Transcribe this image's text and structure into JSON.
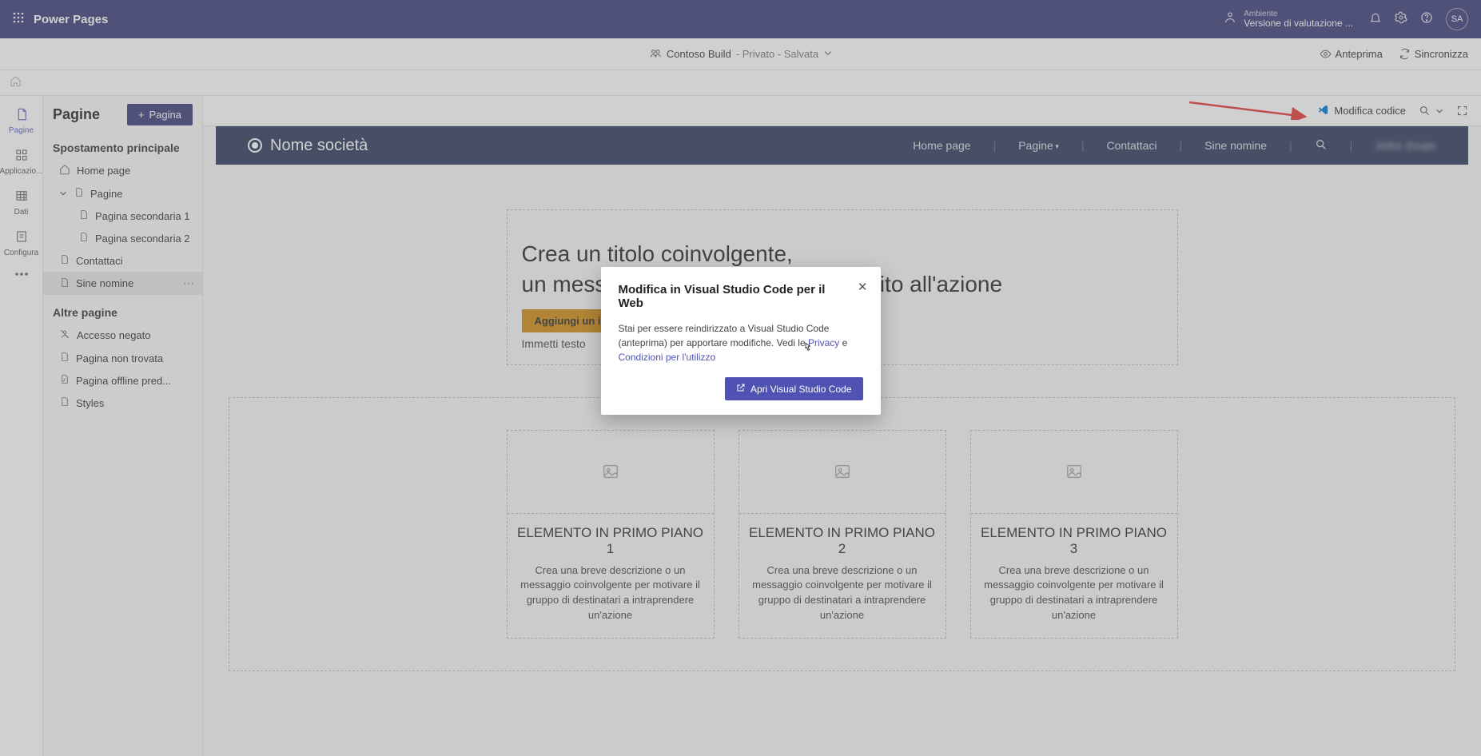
{
  "app_bar": {
    "name": "Power Pages",
    "env_label": "Ambiente",
    "env_value": "Versione di valutazione ...",
    "avatar_initials": "SA"
  },
  "sub_bar": {
    "site_name": "Contoso Build",
    "site_status": "- Privato - Salvata",
    "preview": "Anteprima",
    "sync": "Sincronizza"
  },
  "rail": {
    "pages": "Pagine",
    "apps": "Applicazio...",
    "data": "Dati",
    "setup": "Configura"
  },
  "sidebar": {
    "title": "Pagine",
    "add_page": "Pagina",
    "main_nav": "Spostamento principale",
    "other_pages": "Altre pagine",
    "tree_main": [
      "Home page",
      "Pagine",
      "Pagina secondaria 1",
      "Pagina secondaria 2",
      "Contattaci",
      "Sine nomine"
    ],
    "tree_other": [
      "Accesso negato",
      "Pagina non trovata",
      "Pagina offline pred...",
      "Styles"
    ]
  },
  "design_bar": {
    "edit_code": "Modifica codice"
  },
  "site": {
    "brand": "Nome società",
    "nav": {
      "home": "Home page",
      "pages": "Pagine",
      "contact": "Contattaci",
      "sine": "Sine nomine"
    },
    "hero_line1": "Crea un titolo coinvolgente,",
    "hero_line2": "un messaggio di benvenuto o un invito all'azione",
    "cta": "Aggiungi un invito all'azione",
    "subtext": "Immetti testo",
    "cards": [
      {
        "title": "ELEMENTO IN PRIMO PIANO 1",
        "desc": "Crea una breve descrizione o un messaggio coinvolgente per motivare il gruppo di destinatari a intraprendere un'azione"
      },
      {
        "title": "ELEMENTO IN PRIMO PIANO 2",
        "desc": "Crea una breve descrizione o un messaggio coinvolgente per motivare il gruppo di destinatari a intraprendere un'azione"
      },
      {
        "title": "ELEMENTO IN PRIMO PIANO 3",
        "desc": "Crea una breve descrizione o un messaggio coinvolgente per motivare il gruppo di destinatari a intraprendere un'azione"
      }
    ]
  },
  "modal": {
    "title": "Modifica in Visual Studio Code per il Web",
    "body_pre": "Stai per essere reindirizzato a Visual Studio Code (anteprima) per apportare modifiche. Vedi le ",
    "privacy": "Privacy",
    "and": " e ",
    "terms": "Condizioni per l'utilizzo",
    "open": "Apri Visual Studio Code"
  }
}
